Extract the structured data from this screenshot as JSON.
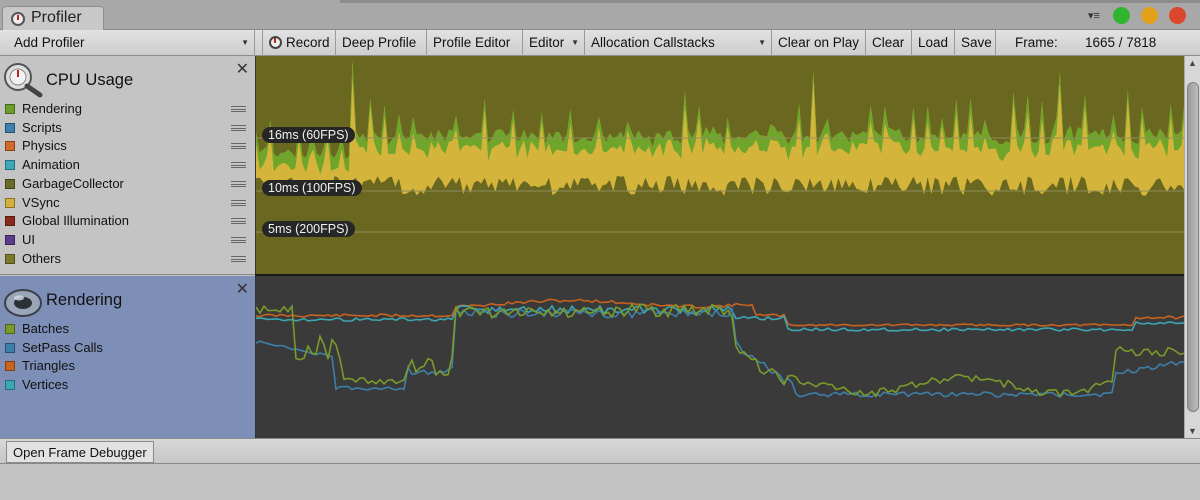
{
  "window": {
    "tab_label": "Profiler",
    "menu_glyph": "▾≡",
    "traffic_lights": [
      "#2fb52f",
      "#e3a01a",
      "#d9472c"
    ]
  },
  "toolbar": {
    "add_profiler": "Add Profiler",
    "record": "Record",
    "deep_profile": "Deep Profile",
    "profile_editor": "Profile Editor",
    "editor": "Editor",
    "allocation_callstacks": "Allocation Callstacks",
    "clear_on_play": "Clear on Play",
    "clear": "Clear",
    "load": "Load",
    "save": "Save",
    "frame_label": "Frame:",
    "frame_value": "1665 / 7818"
  },
  "cpu_panel": {
    "title": "CPU Usage",
    "close": "✕",
    "legend": [
      {
        "label": "Rendering",
        "color": "#6c9f2a"
      },
      {
        "label": "Scripts",
        "color": "#3e7fb0"
      },
      {
        "label": "Physics",
        "color": "#d06a26"
      },
      {
        "label": "Animation",
        "color": "#3da9b8"
      },
      {
        "label": "GarbageCollector",
        "color": "#6a6a2a"
      },
      {
        "label": "VSync",
        "color": "#d2b03a"
      },
      {
        "label": "Global Illumination",
        "color": "#8a2a1a"
      },
      {
        "label": "UI",
        "color": "#5b3b8c"
      },
      {
        "label": "Others",
        "color": "#7c7a2a"
      }
    ],
    "fps_labels": [
      "16ms (60FPS)",
      "10ms (100FPS)",
      "5ms (200FPS)"
    ]
  },
  "rendering_panel": {
    "title": "Rendering",
    "close": "✕",
    "legend": [
      {
        "label": "Batches",
        "color": "#7a9a2a"
      },
      {
        "label": "SetPass Calls",
        "color": "#3d7fa8"
      },
      {
        "label": "Triangles",
        "color": "#c8621f"
      },
      {
        "label": "Vertices",
        "color": "#3aa7b2"
      }
    ]
  },
  "bottom": {
    "open_frame_debugger": "Open Frame Debugger"
  }
}
